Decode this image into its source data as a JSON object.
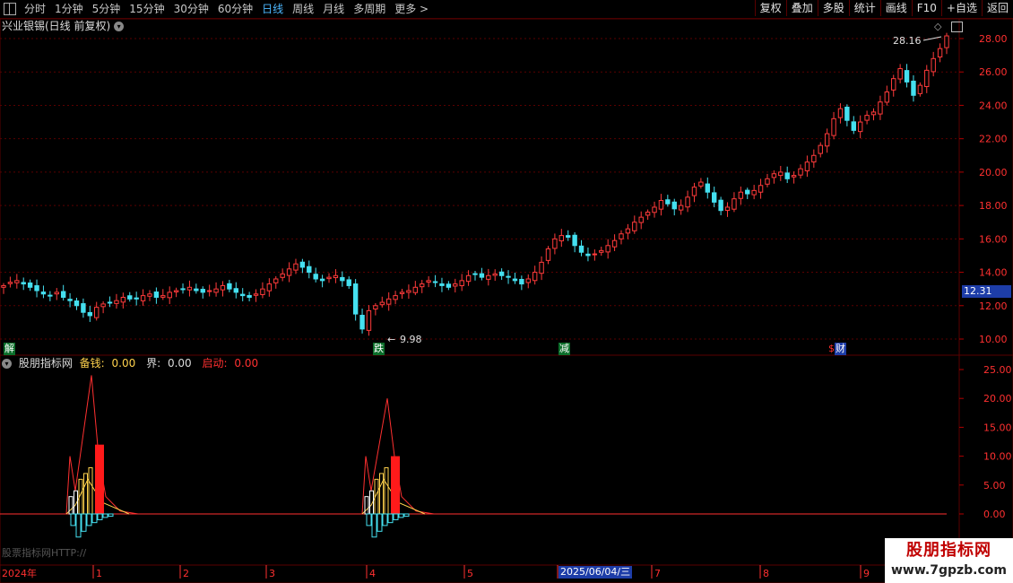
{
  "toolbar": {
    "periods": [
      "分时",
      "1分钟",
      "5分钟",
      "15分钟",
      "30分钟",
      "60分钟",
      "日线",
      "周线",
      "月线",
      "多周期",
      "更多"
    ],
    "active_period": "日线",
    "more_arrow": ">",
    "buttons": [
      "复权",
      "叠加",
      "多股",
      "统计",
      "画线",
      "F10",
      "+自选",
      "返回"
    ]
  },
  "main_chart": {
    "title": "兴业银锡(日线 前复权)",
    "high_label": "28.16",
    "low_label": "9.98",
    "current_price": "12.31",
    "price_axis": [
      "28.00",
      "26.00",
      "24.00",
      "22.00",
      "20.00",
      "18.00",
      "16.00",
      "14.00",
      "12.00",
      "10.00"
    ],
    "markers": [
      {
        "text": "解",
        "color": "#0b6e2a"
      },
      {
        "text": "跌",
        "color": "#0b6e2a"
      },
      {
        "text": "减",
        "color": "#0b6e2a"
      },
      {
        "text": "$",
        "color": "#b00000"
      },
      {
        "text": "财",
        "color": "#1d3da8"
      }
    ]
  },
  "sub_chart": {
    "title": "股朋指标网",
    "params": [
      {
        "label": "备钱:",
        "value": "0.00",
        "color": "#ffd24d"
      },
      {
        "label": "界:",
        "value": "0.00",
        "color": "#dcdcdc"
      },
      {
        "label": "启动:",
        "value": "0.00",
        "color": "#ff3030"
      }
    ],
    "axis": [
      "25.00",
      "20.00",
      "15.00",
      "10.00",
      "5.00",
      "0.00"
    ]
  },
  "time_axis": {
    "year_label": "2024年",
    "months": [
      "1",
      "2",
      "3",
      "4",
      "5",
      "6",
      "7",
      "8",
      "9"
    ],
    "crosshair_date": "2025/06/04/三"
  },
  "watermarks": {
    "small": "股票指标网HTTP://",
    "brand": "股朋指标网",
    "url": "www.7gpzb.com"
  },
  "colors": {
    "up": "#ff3b3b",
    "down": "#45e0f0",
    "grid": "#5a0000",
    "accent": "#1d3da8"
  },
  "chart_data": {
    "type": "candlestick",
    "y_axis": {
      "min": 9.5,
      "max": 28.8
    },
    "x_axis": {
      "start": "2024-01",
      "months": [
        "1",
        "2",
        "3",
        "4",
        "5",
        "6",
        "7",
        "8",
        "9"
      ]
    },
    "highlight": {
      "high": 28.16,
      "low": 9.98,
      "last": 12.31
    },
    "close_path": [
      13.2,
      13.4,
      13.5,
      13.3,
      13.1,
      12.9,
      12.7,
      12.6,
      12.8,
      12.5,
      12.3,
      12.0,
      11.6,
      11.4,
      11.9,
      12.1,
      12.2,
      12.3,
      12.5,
      12.4,
      12.4,
      12.6,
      12.7,
      12.5,
      12.6,
      12.8,
      12.9,
      13.0,
      13.1,
      12.9,
      12.8,
      12.9,
      13.0,
      13.2,
      13.0,
      12.8,
      12.6,
      12.5,
      12.7,
      13.0,
      13.3,
      13.6,
      13.9,
      14.2,
      14.5,
      14.3,
      14.0,
      13.6,
      13.5,
      13.7,
      13.8,
      13.5,
      13.2,
      11.5,
      10.6,
      11.7,
      12.0,
      12.2,
      12.4,
      12.6,
      12.8,
      12.9,
      13.1,
      13.3,
      13.5,
      13.4,
      13.2,
      13.1,
      13.3,
      13.5,
      13.8,
      13.9,
      13.7,
      13.8,
      13.9,
      13.8,
      13.7,
      13.5,
      13.3,
      13.6,
      14.0,
      14.6,
      15.4,
      16.0,
      16.2,
      16.1,
      15.6,
      15.2,
      15.0,
      15.1,
      15.3,
      15.6,
      15.9,
      16.3,
      16.6,
      17.0,
      17.3,
      17.6,
      17.9,
      18.3,
      18.1,
      17.8,
      18.0,
      18.5,
      19.1,
      19.4,
      18.8,
      18.2,
      17.7,
      17.9,
      18.4,
      18.8,
      18.7,
      18.9,
      19.2,
      19.6,
      19.9,
      20.0,
      19.6,
      19.8,
      20.2,
      20.6,
      21.0,
      21.6,
      22.3,
      23.2,
      23.8,
      23.1,
      22.5,
      23.0,
      23.4,
      23.6,
      24.2,
      24.8,
      25.6,
      26.2,
      25.4,
      24.6,
      25.2,
      26.1,
      26.8,
      27.4,
      28.16
    ]
  }
}
